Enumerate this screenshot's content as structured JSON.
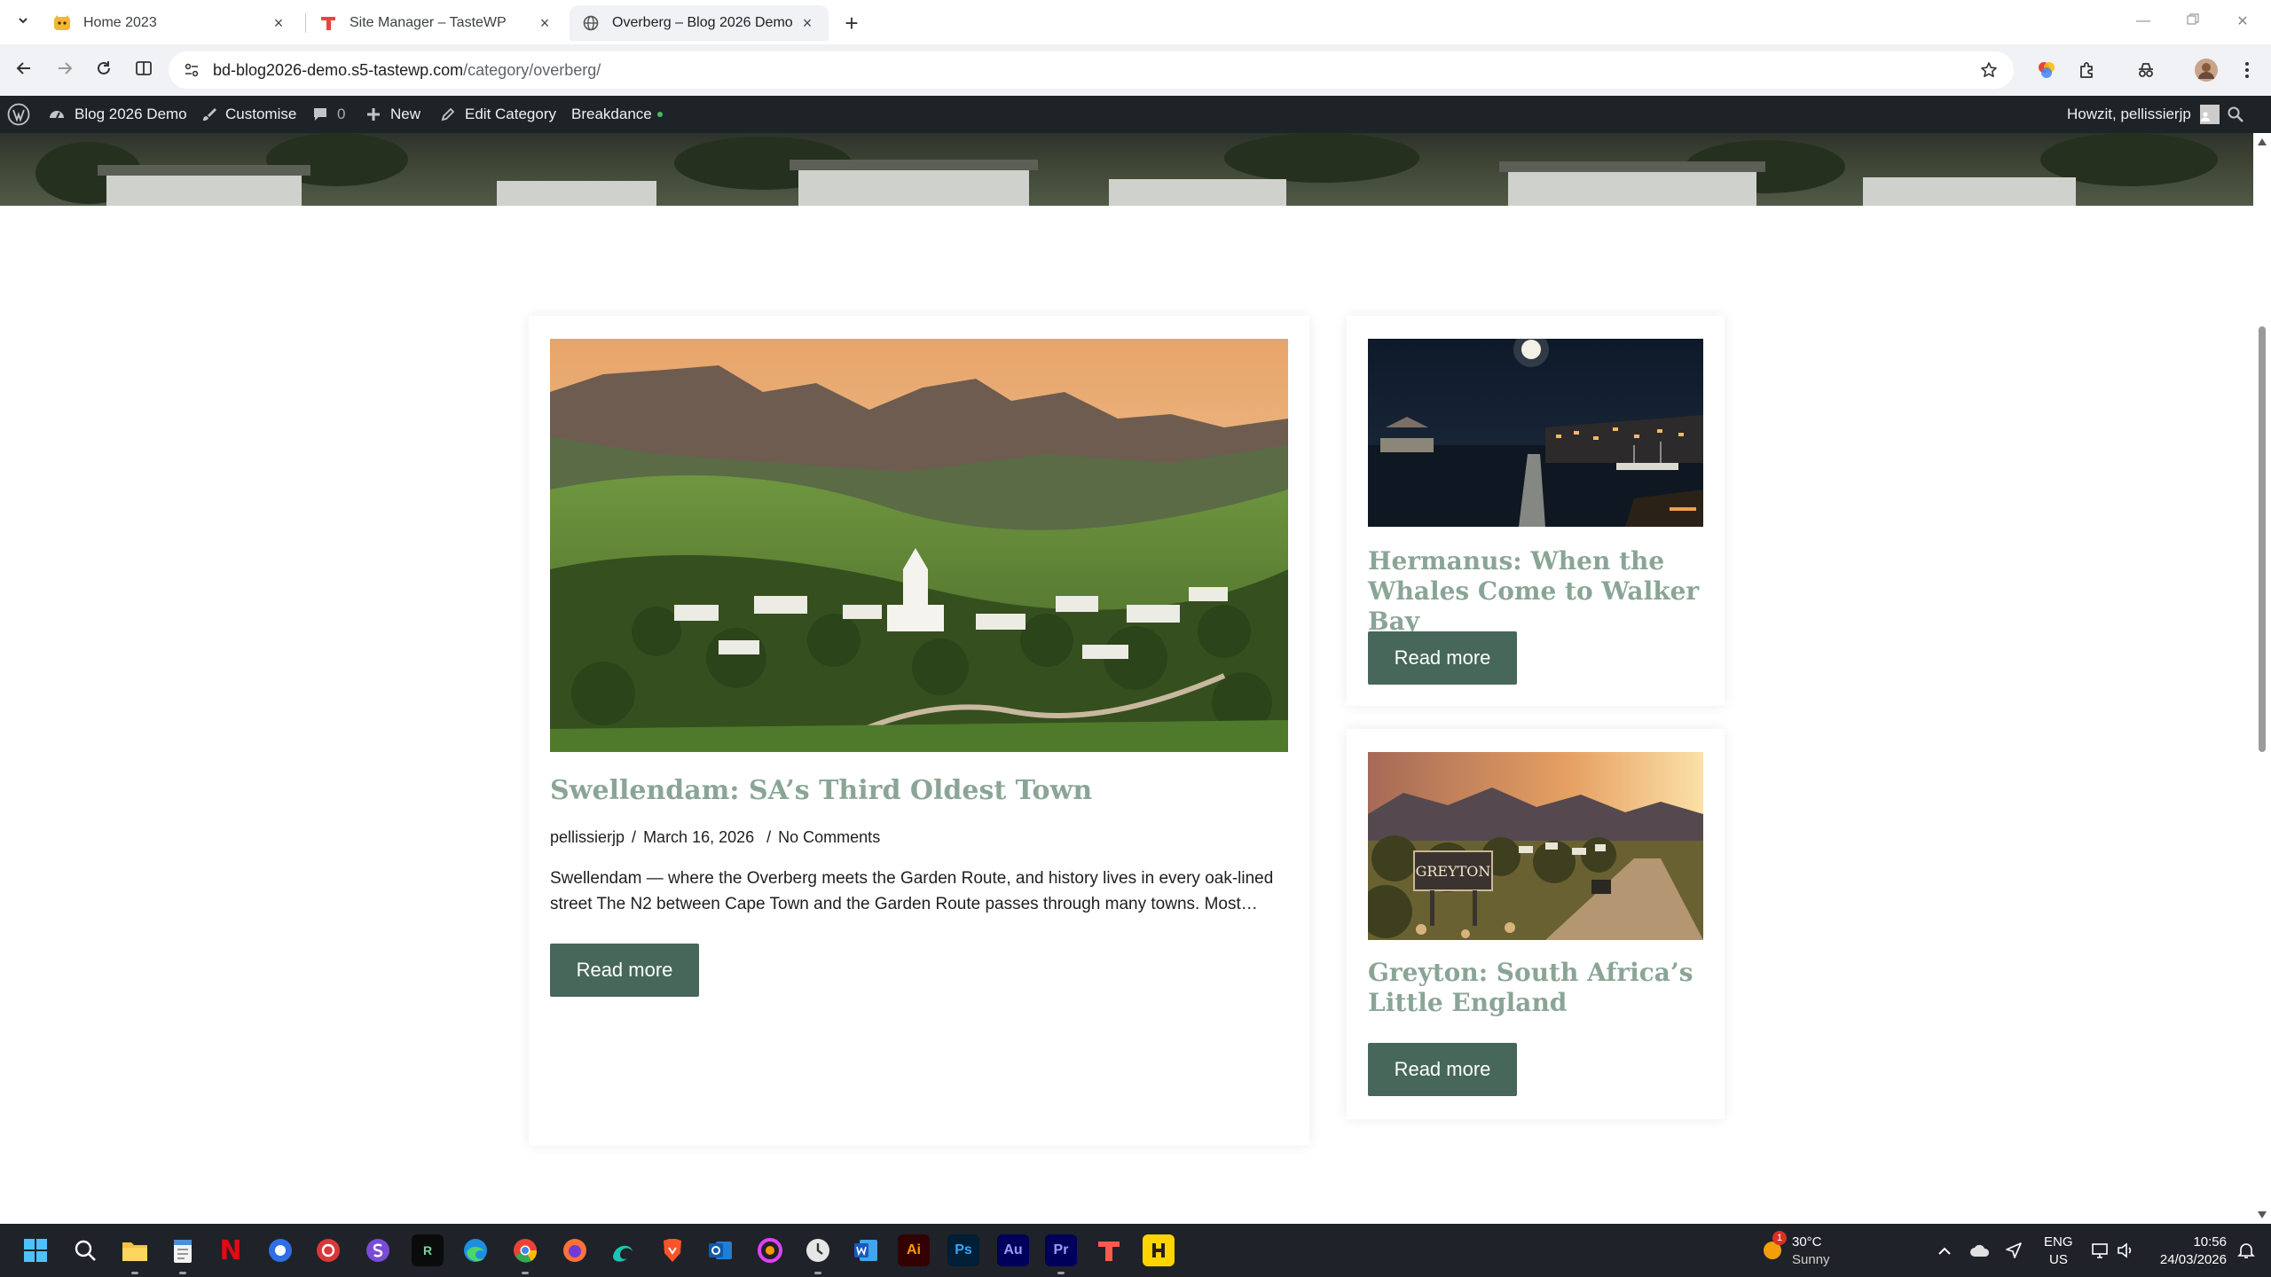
{
  "browser": {
    "tabs": [
      {
        "title": "Home 2023",
        "active": false
      },
      {
        "title": "Site Manager – TasteWP",
        "active": false
      },
      {
        "title": "Overberg – Blog 2026 Demo",
        "active": true
      }
    ],
    "url_host": "bd-blog2026-demo.s5-tastewp.com",
    "url_path": "/category/overberg/"
  },
  "admin_bar": {
    "site_name": "Blog 2026 Demo",
    "customise": "Customise",
    "comments_count": "0",
    "new": "New",
    "edit_category": "Edit Category",
    "breakdance": "Breakdance",
    "greeting": "Howzit, pellissierjp"
  },
  "posts": {
    "featured": {
      "title": "Swellendam: SA’s Third Oldest Town",
      "author": "pellissierjp",
      "date": "March 16, 2026",
      "comments": "No Comments",
      "excerpt": "Swellendam — where the Overberg meets the Garden Route, and history lives in every oak-lined street The N2 between Cape Town and the Garden Route passes through many towns. Most…",
      "read_more": "Read more"
    },
    "side": [
      {
        "title": "Hermanus: When the Whales Come to Walker Bay",
        "read_more": "Read more"
      },
      {
        "title": "Greyton: South Africa’s Little England",
        "read_more": "Read more",
        "sign_text": "GREYTON"
      }
    ]
  },
  "taskbar": {
    "weather_temp": "30°C",
    "weather_desc": "Sunny",
    "weather_badge": "1",
    "lang_line1": "ENG",
    "lang_line2": "US",
    "time": "10:56",
    "date": "24/03/2026",
    "apps": [
      "Ai",
      "Ps",
      "Au",
      "Pr"
    ]
  },
  "colors": {
    "accent_green": "#46675a",
    "title_green": "#8aa596",
    "admin_bar": "#1d2327"
  }
}
